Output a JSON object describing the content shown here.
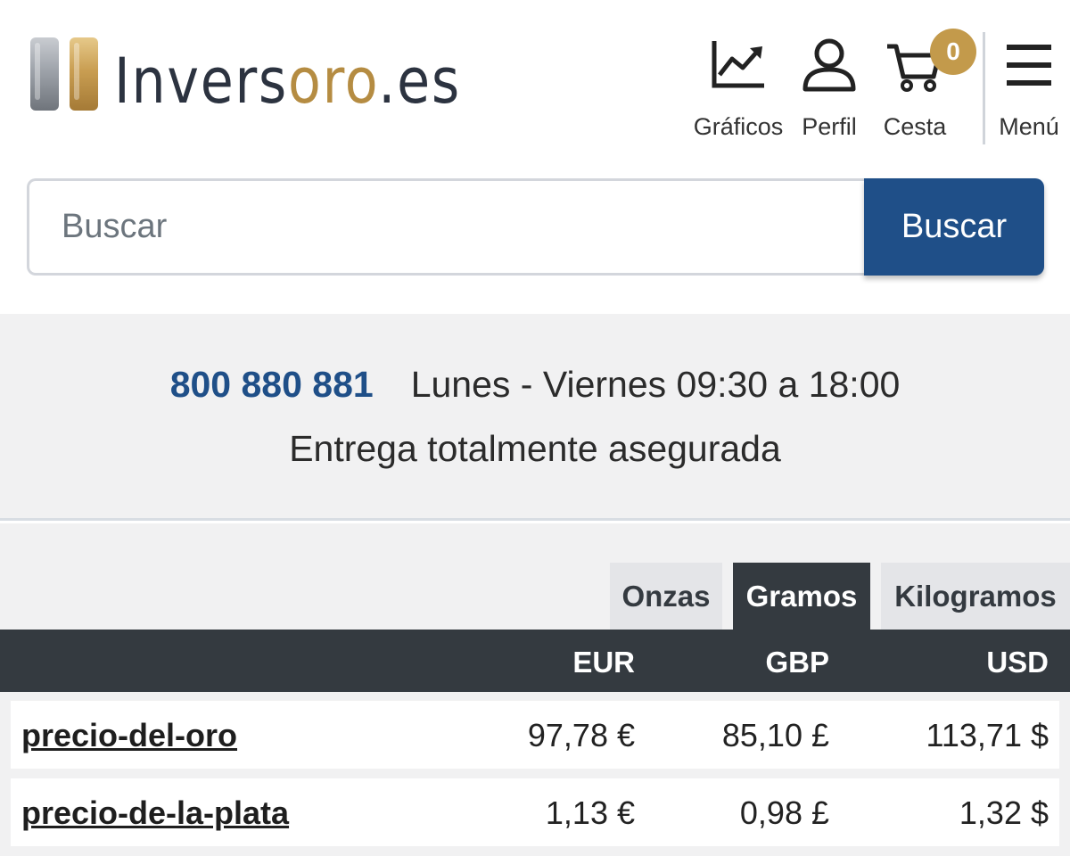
{
  "header": {
    "logo": {
      "text_main": "Invers",
      "text_gold": "oro",
      "text_end": ".es"
    },
    "nav": [
      {
        "label": "Gráficos",
        "icon": "chart-line-icon"
      },
      {
        "label": "Perfil",
        "icon": "user-icon"
      },
      {
        "label": "Cesta",
        "icon": "cart-icon",
        "badge": "0"
      },
      {
        "label": "Menú",
        "icon": "hamburger-menu-icon"
      }
    ]
  },
  "search": {
    "placeholder": "Buscar",
    "value": "",
    "button_label": "Buscar"
  },
  "info": {
    "phone": "800 880 881",
    "hours": "Lunes - Viernes 09:30 a 18:00",
    "delivery": "Entrega totalmente asegurada"
  },
  "prices": {
    "unit_tabs": [
      {
        "label": "Onzas",
        "active": false
      },
      {
        "label": "Gramos",
        "active": true
      },
      {
        "label": "Kilogramos",
        "active": false
      }
    ],
    "columns": [
      "EUR",
      "GBP",
      "USD"
    ],
    "rows": [
      {
        "name": "precio-del-oro",
        "eur": "97,78 €",
        "gbp": "85,10 £",
        "usd": "113,71 $"
      },
      {
        "name": "precio-de-la-plata",
        "eur": "1,13 €",
        "gbp": "0,98 £",
        "usd": "1,32 $"
      }
    ]
  },
  "colors": {
    "brand_blue": "#1f4f88",
    "gold": "#c39a4b",
    "dark_header": "#343a40",
    "band_bg": "#f1f1f2"
  }
}
